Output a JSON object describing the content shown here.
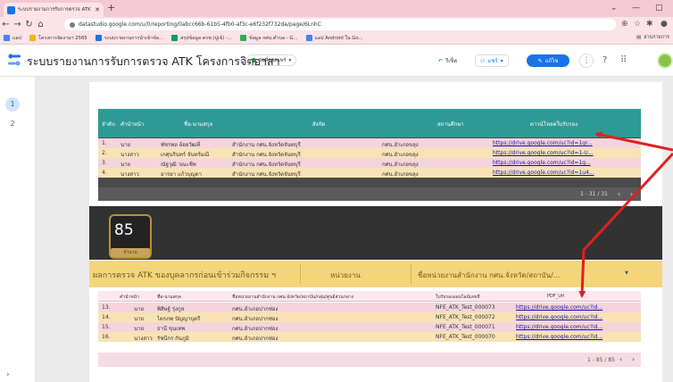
{
  "browser": {
    "tab_title": "ระบบรายงานการรับการตรวจ ATK โดย",
    "url": "datastudio.google.com/u/0/reporting/0abcc66b-61b5-4fb0-af3c-e6f232f732da/page/6LnhC",
    "bookmarks": [
      {
        "label": "แอป",
        "color": "#4285f4"
      },
      {
        "label": "โครงการจัดงานฯ 2565",
        "color": "#f4b400"
      },
      {
        "label": "ระบบรายงานการนำเข้าข้อ...",
        "color": "#1a73e8"
      },
      {
        "label": "สรุปข้อมูล ครช.(ปูเข้) -...",
        "color": "#0f9d58"
      },
      {
        "label": "ข้อมูล กศน.ตำบล - G...",
        "color": "#34a853"
      },
      {
        "label": "แอป Android ใน Go...",
        "color": "#4285f4"
      }
    ],
    "bookmarks_right": "อ่านรายการ"
  },
  "header": {
    "title": "ระบบรายงานการรับการตรวจ ATK โครงการจิตอาสา",
    "status": "รุ่นที่แผยแพร่",
    "reset": "รีเซ็ต",
    "share": "แชร์",
    "edit": "แก้ไข"
  },
  "pagenav": {
    "pages": [
      "1",
      "2"
    ]
  },
  "table1": {
    "headers": [
      "ลำดับ",
      "คำนำหน้า",
      "ชื่อ-นามสกุล",
      "สังกัด",
      "สถานศึกษา",
      "ดาวน์โหลดใบรับรอง"
    ],
    "rows": [
      {
        "no": "1.",
        "prefix": "นาย",
        "name": "พัชรพล ย้อยวัฒที่",
        "org": "สำนักงาน กศน.จังหวัดจันทบุรี",
        "school": "กศน.อำเภอขลุง",
        "link": "https://drive.google.com/uc?id=1gr...",
        "bg": "#f6d4dc"
      },
      {
        "no": "2.",
        "prefix": "นางสาว",
        "name": "เกศุนรินทร์ จันทร์มณี",
        "org": "สำนักงาน กศน.จังหวัดจันทบุรี",
        "school": "กศน.อำเภอขลุง",
        "link": "https://drive.google.com/uc?id=1-U...",
        "bg": "#f8e3b5"
      },
      {
        "no": "3.",
        "prefix": "นาย",
        "name": "ณัฐวุฒิ วณะชีพ",
        "org": "สำนักงาน กศน.จังหวัดจันทบุรี",
        "school": "กศน.อำเภอขลุง",
        "link": "https://drive.google.com/uc?id=1g...",
        "bg": "#f6d4dc"
      },
      {
        "no": "4.",
        "prefix": "นางสาว",
        "name": "อารยา แก้วบุญตา",
        "org": "สำนักงาน กศน.จังหวัดจันทบุรี",
        "school": "กศน.อำเภอขลุง",
        "link": "https://drive.google.com/uc?id=1u4...",
        "bg": "#f8e3b5"
      }
    ],
    "pager": "1 - 31 / 31"
  },
  "badge": {
    "number": "85",
    "ribbon": "จำนวน"
  },
  "filterbar": {
    "title": "ผลการตรวจ ATK ของบุคลากรก่อนเข้าร่วมกิจกรรม ฯ",
    "field1": "หน่วยงาน",
    "field2": "ชื่อหน่วยงานสำนักงาน กศน.จังหวัด/สถาบัน/..."
  },
  "table2": {
    "headers": [
      "คำนำหน้า",
      "ชื่อ-นามสกุล",
      "ชื่อหน่วยงานสำนักงาน กศน.จังหวัด/สถาบัน/กลุ่ม/ศูนย์ส่วนกลาง",
      "ใบรับรองออนไลน์เลขที่",
      "PDF_Url"
    ],
    "rows": [
      {
        "no": "13.",
        "prefix": "นาย",
        "name": "พิสิษฐ์ รุ่งกูล",
        "unit": "กศน.อำเภอปากช่อง",
        "cert": "NFE_ATK_Test_000073",
        "link": "https://drive.google.com/uc?id...",
        "bg": "#f6d4dc"
      },
      {
        "no": "14.",
        "prefix": "นาย",
        "name": "ไตรภพ ปัญญาบุตรี",
        "unit": "กศน.อำเภอปากช่อง",
        "cert": "NFE_ATK_Test_000072",
        "link": "https://drive.google.com/uc?id...",
        "bg": "#f8e3b5"
      },
      {
        "no": "15.",
        "prefix": "นาย",
        "name": "ธานี ขุนเทพ",
        "unit": "กศน.อำเภอปากช่อง",
        "cert": "NFE_ATK_Test_000071",
        "link": "https://drive.google.com/uc?id...",
        "bg": "#f6d4dc"
      },
      {
        "no": "16.",
        "prefix": "นางสาว",
        "name": "รัชนีกร กันภูมิ",
        "unit": "กศน.อำเภอปากช่อง",
        "cert": "NFE_ATK_Test_000070",
        "link": "https://drive.google.com/uc?id...",
        "bg": "#f8e3b5"
      }
    ],
    "pager": "1 - 85 / 85"
  },
  "colors": {
    "accent": "#1a73e8",
    "teal": "#2e9a95",
    "gold": "#f4d57c",
    "annotation": "#e02020"
  }
}
